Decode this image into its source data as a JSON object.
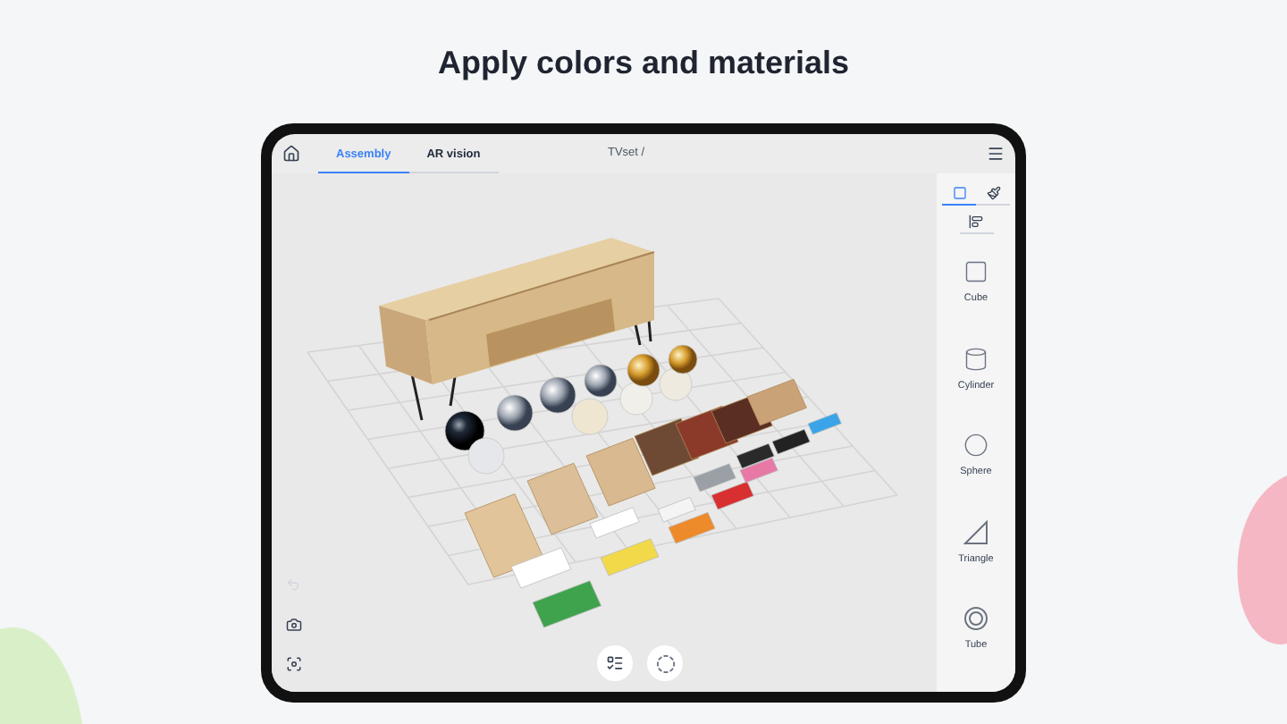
{
  "page_title": "Apply colors and materials",
  "app": {
    "tabs": [
      {
        "label": "Assembly",
        "selected": true
      },
      {
        "label": "AR vision",
        "selected": false
      }
    ],
    "document_title": "TVset /",
    "panel_tabs": [
      {
        "kind": "shapes",
        "selected": true
      },
      {
        "kind": "materials",
        "selected": false
      },
      {
        "kind": "align",
        "selected": false
      }
    ],
    "shapes": [
      {
        "label": "Cube",
        "kind": "cube"
      },
      {
        "label": "Cylinder",
        "kind": "cylinder"
      },
      {
        "label": "Sphere",
        "kind": "sphere"
      },
      {
        "label": "Triangle",
        "kind": "triangle"
      },
      {
        "label": "Tube",
        "kind": "tube"
      }
    ]
  }
}
